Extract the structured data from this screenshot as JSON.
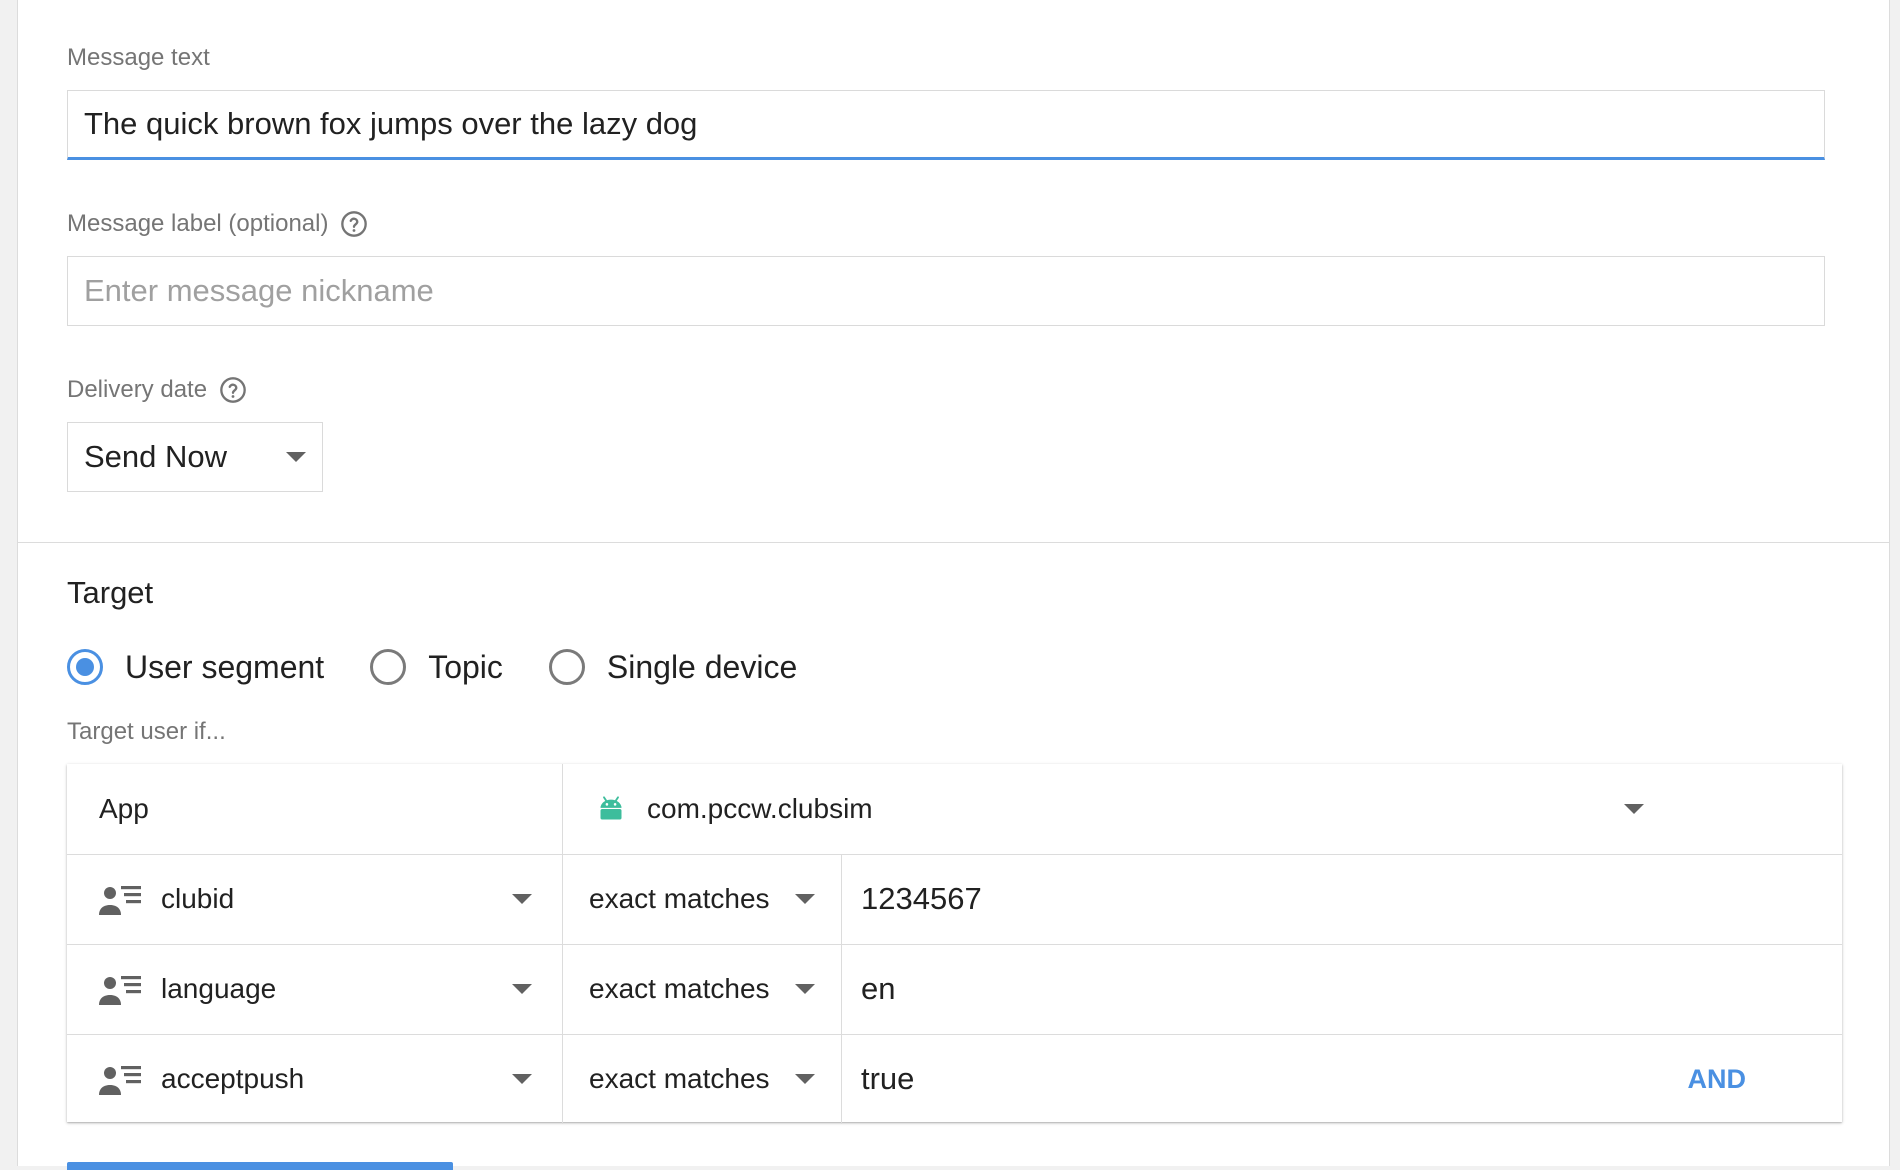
{
  "message_text": {
    "label": "Message text",
    "value": "The quick brown fox jumps over the lazy dog"
  },
  "message_label": {
    "label": "Message label (optional)",
    "placeholder": "Enter message nickname"
  },
  "delivery_date": {
    "label": "Delivery date",
    "selected": "Send Now"
  },
  "target": {
    "title": "Target",
    "options": [
      "User segment",
      "Topic",
      "Single device"
    ],
    "selected_index": 0,
    "hint": "Target user if..."
  },
  "rules": {
    "app_row": {
      "label": "App",
      "value": "com.pccw.clubsim"
    },
    "conditions": [
      {
        "property": "clubid",
        "operator": "exact matches",
        "value": "1234567"
      },
      {
        "property": "language",
        "operator": "exact matches",
        "value": "en"
      },
      {
        "property": "acceptpush",
        "operator": "exact matches",
        "value": "true"
      }
    ],
    "and_label": "AND"
  },
  "colors": {
    "accent": "#4a90e2",
    "android": "#3dbd9c"
  }
}
